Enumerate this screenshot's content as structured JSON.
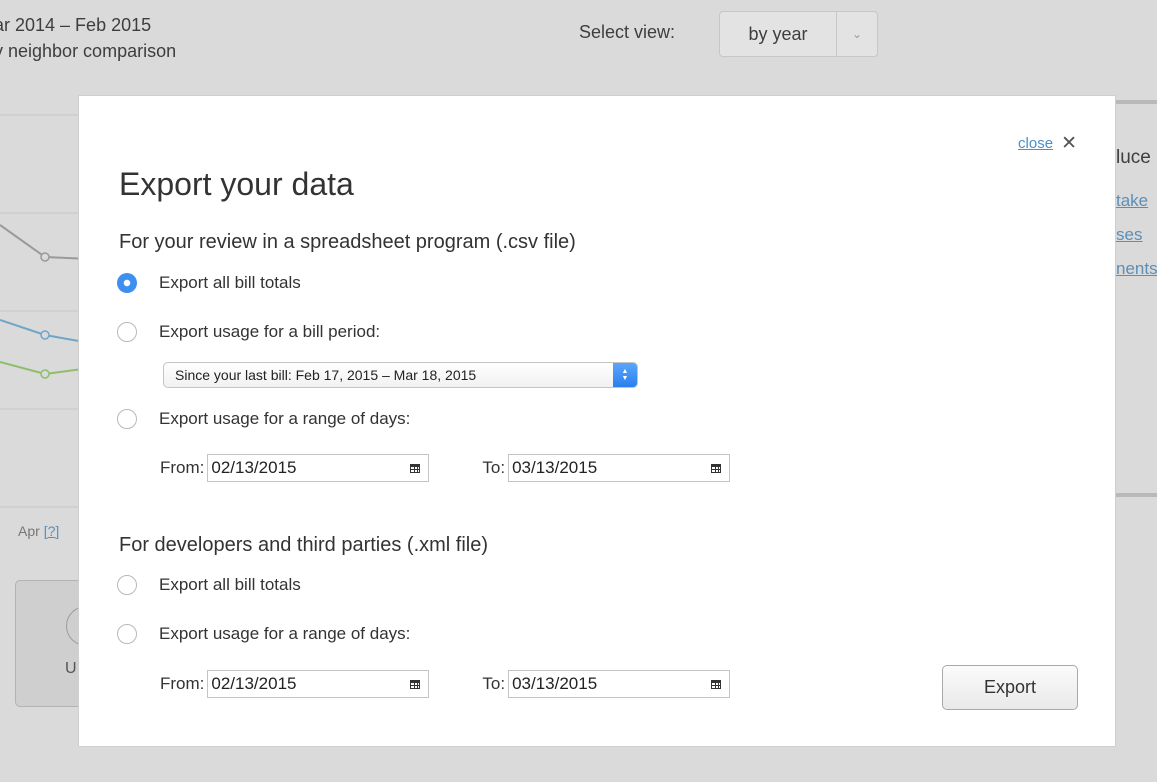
{
  "background": {
    "header_line1": "ar 2014 – Feb 2015",
    "header_line2": "y neighbor comparison",
    "select_view_label": "Select view:",
    "select_view_value": "by year",
    "tick_label": "Apr",
    "tick_help": "[?]",
    "card_text": "U",
    "right_heading": "luce",
    "right_links": [
      "take",
      "ses",
      "nents"
    ]
  },
  "modal": {
    "close_label": "close",
    "title": "Export your data",
    "csv_section": {
      "title": "For your review in a spreadsheet program (.csv file)",
      "opt_bill_totals": "Export all bill totals",
      "opt_bill_period": "Export usage for a bill period:",
      "bill_period_value": "Since your last bill: Feb 17, 2015 – Mar 18, 2015",
      "opt_range": "Export usage for a range of days:",
      "from_label": "From:",
      "from_value": "02/13/2015",
      "to_label": "To:",
      "to_value": "03/13/2015",
      "selected": "bill_totals"
    },
    "xml_section": {
      "title": "For developers and third parties (.xml file)",
      "opt_bill_totals": "Export all bill totals",
      "opt_range": "Export usage for a range of days:",
      "from_label": "From:",
      "from_value": "02/13/2015",
      "to_label": "To:",
      "to_value": "03/13/2015"
    },
    "export_label": "Export"
  },
  "colors": {
    "radio_selected": "#3d8ff0",
    "link": "#4a90c8",
    "overlay": "#dadada"
  }
}
